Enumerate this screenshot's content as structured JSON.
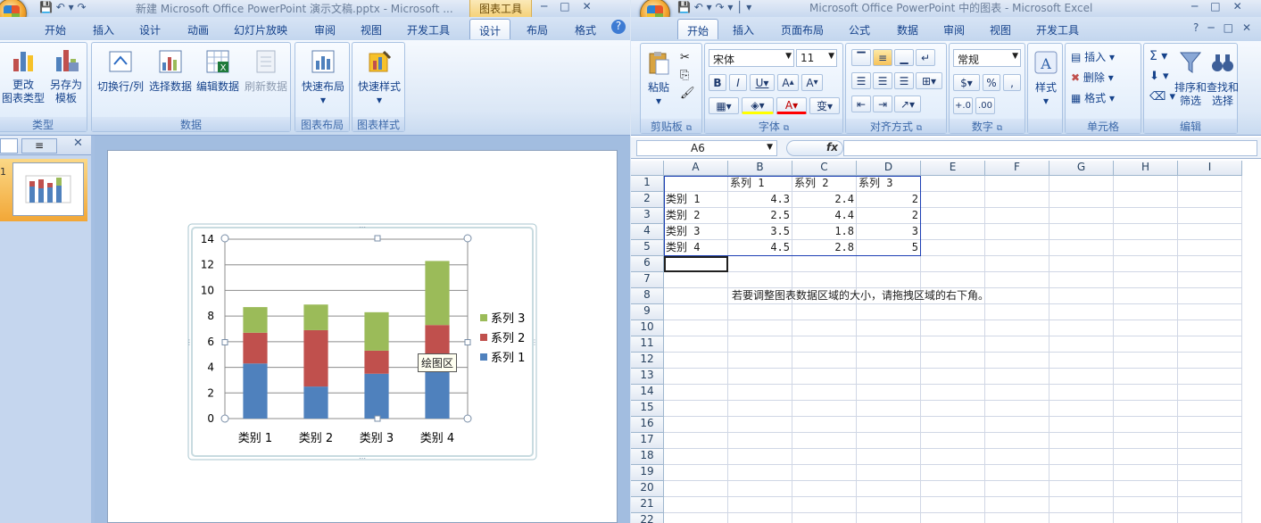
{
  "ppt": {
    "title": "新建 Microsoft Office PowerPoint 演示文稿.pptx - Microsoft ...",
    "context_tab_label": "图表工具",
    "tabs": [
      "开始",
      "插入",
      "设计",
      "动画",
      "幻灯片放映",
      "审阅",
      "视图",
      "开发工具",
      "设计",
      "布局",
      "格式"
    ],
    "active_tab_index": 8,
    "groups": {
      "type": {
        "label": "类型",
        "buttons": [
          {
            "line1": "更改",
            "line2": "图表类型"
          },
          {
            "line1": "另存为",
            "line2": "模板"
          }
        ]
      },
      "data": {
        "label": "数据",
        "buttons": [
          "切换行/列",
          "选择数据",
          "编辑数据",
          "刷新数据"
        ]
      },
      "layout": {
        "label": "图表布局",
        "button": "快速布局"
      },
      "style": {
        "label": "图表样式",
        "button": "快速样式"
      }
    },
    "tooltip": "绘图区"
  },
  "chart_data": {
    "type": "bar",
    "stacked": true,
    "categories": [
      "类别 1",
      "类别 2",
      "类别 3",
      "类别 4"
    ],
    "series": [
      {
        "name": "系列 1",
        "values": [
          4.3,
          2.5,
          3.5,
          4.5
        ],
        "color": "#4f81bd"
      },
      {
        "name": "系列 2",
        "values": [
          2.4,
          4.4,
          1.8,
          2.8
        ],
        "color": "#c0504d"
      },
      {
        "name": "系列 3",
        "values": [
          2,
          2,
          3,
          5
        ],
        "color": "#9bbb59"
      }
    ],
    "ylim": [
      0,
      14
    ],
    "yticks": [
      "0",
      "2",
      "4",
      "6",
      "8",
      "10",
      "12",
      "14"
    ],
    "grid": true,
    "legend": "right"
  },
  "excel": {
    "title": "Microsoft Office PowerPoint 中的图表 - Microsoft Excel",
    "tabs": [
      "开始",
      "插入",
      "页面布局",
      "公式",
      "数据",
      "审阅",
      "视图",
      "开发工具"
    ],
    "active_tab_index": 0,
    "font_name": "宋体",
    "font_size": "11",
    "number_format": "常规",
    "groups": [
      "剪贴板",
      "字体",
      "对齐方式",
      "数字",
      "样式",
      "单元格",
      "编辑"
    ],
    "paste_label": "粘贴",
    "style_label": "样式",
    "cells_buttons": [
      "插入",
      "删除",
      "格式"
    ],
    "edit_buttons": [
      {
        "line1": "排序和",
        "line2": "筛选"
      },
      {
        "line1": "查找和",
        "line2": "选择"
      }
    ],
    "name_box": "A6",
    "fx_label": "fx",
    "columns": [
      "A",
      "B",
      "C",
      "D",
      "E",
      "F",
      "G",
      "H",
      "I"
    ],
    "rows": [
      "1",
      "2",
      "3",
      "4",
      "5",
      "6",
      "7",
      "8",
      "9",
      "10",
      "11",
      "12",
      "13",
      "14",
      "15",
      "16",
      "17",
      "18",
      "19",
      "20",
      "21",
      "22"
    ],
    "table": {
      "header": [
        "",
        "系列 1",
        "系列 2",
        "系列 3"
      ],
      "body": [
        [
          "类别 1",
          "4.3",
          "2.4",
          "2"
        ],
        [
          "类别 2",
          "2.5",
          "4.4",
          "2"
        ],
        [
          "类别 3",
          "3.5",
          "1.8",
          "3"
        ],
        [
          "类别 4",
          "4.5",
          "2.8",
          "5"
        ]
      ]
    },
    "hint": "若要调整图表数据区域的大小，请拖拽区域的右下角。"
  },
  "colors": {
    "ribbon_text": "#15428b",
    "accent": "#f5d27a"
  }
}
